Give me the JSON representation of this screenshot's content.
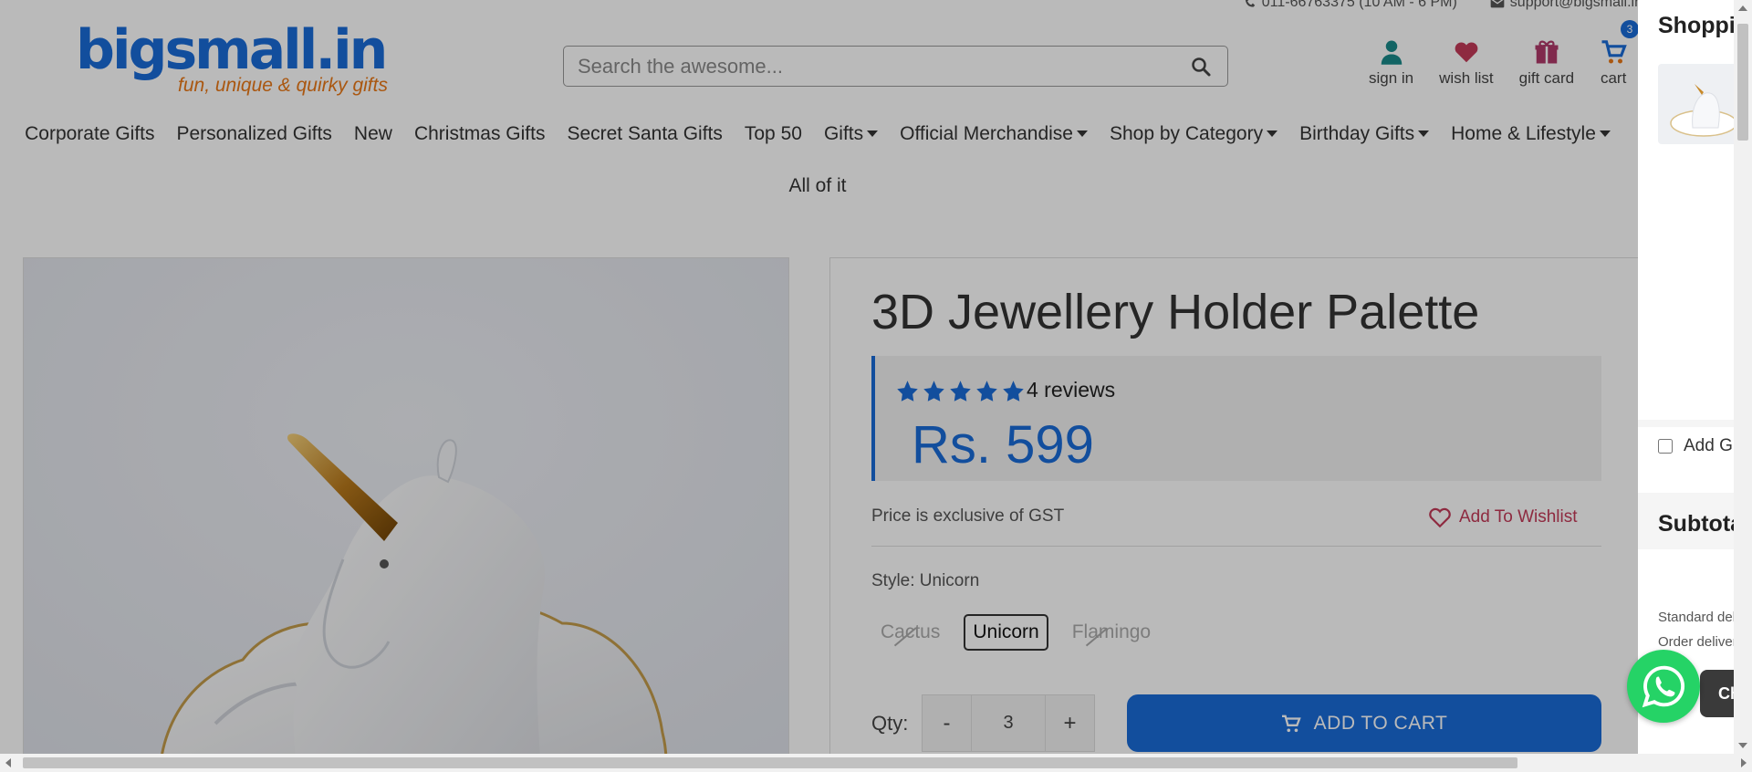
{
  "topbar": {
    "phone": "011-66763375 (10 AM - 6 PM)",
    "email": "support@bigsmall.in"
  },
  "logo": {
    "name": "bigsmall.in",
    "tagline": "fun, unique & quirky gifts"
  },
  "search": {
    "placeholder": "Search the awesome..."
  },
  "header_icons": {
    "sign_in": "sign in",
    "wish_list": "wish list",
    "gift_card": "gift card",
    "cart": "cart",
    "cart_count": "3"
  },
  "nav": {
    "items": [
      "Corporate Gifts",
      "Personalized Gifts",
      "New",
      "Christmas Gifts",
      "Secret Santa Gifts",
      "Top 50",
      "Gifts",
      "Official Merchandise",
      "Shop by Category",
      "Birthday Gifts",
      "Home & Lifestyle",
      "All of it"
    ]
  },
  "product": {
    "title": "3D Jewellery Holder Palette",
    "rating": 5,
    "reviews": "4 reviews",
    "price": "Rs. 599",
    "gst_note": "Price is exclusive of GST",
    "wishlist": "Add To Wishlist",
    "style_label": "Style: Unicorn",
    "styles": [
      "Cactus",
      "Unicorn",
      "Flamingo"
    ],
    "qty_label": "Qty:",
    "qty_minus": "-",
    "qty_value": "3",
    "qty_plus": "+",
    "add_to_cart": "ADD TO CART"
  },
  "drawer": {
    "title": "Shopping Cart",
    "checkbox_label": "Add Gift Wrap",
    "subtotal_label": "Subtotal",
    "note1": "Standard delivery",
    "note2": "Order delivery",
    "chat_label": "Chat"
  },
  "colors": {
    "brand_blue": "#1a6bd8",
    "brand_orange": "#e97817",
    "wishlist_red": "#c33a58",
    "whatsapp_green": "#25d366"
  }
}
